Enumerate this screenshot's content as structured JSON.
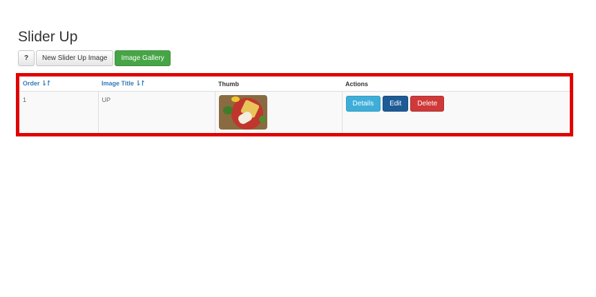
{
  "page": {
    "title": "Slider Up"
  },
  "toolbar": {
    "help_label": "?",
    "new_label": "New Slider Up Image",
    "gallery_label": "Image Gallery"
  },
  "table": {
    "headers": {
      "order": "Order",
      "image_title": "Image Title",
      "thumb": "Thumb",
      "actions": "Actions"
    },
    "sort_icon": "⇂↾",
    "rows": [
      {
        "order": "1",
        "image_title": "UP",
        "thumb_icon": "food-plate-image"
      }
    ]
  },
  "actions": {
    "details_label": "Details",
    "edit_label": "Edit",
    "delete_label": "Delete"
  },
  "colors": {
    "highlight_border": "#e00000",
    "sort_link": "#337ab7",
    "gallery_button": "#46a546",
    "details": "#3eaed8",
    "edit": "#1e5b96",
    "delete": "#d0393a"
  }
}
